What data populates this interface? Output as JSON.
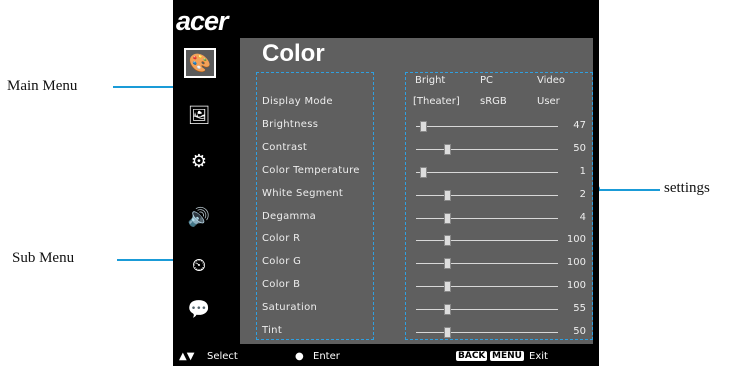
{
  "callouts": {
    "main_menu": "Main Menu",
    "sub_menu": "Sub Menu",
    "settings": "settings"
  },
  "logo": "acer",
  "panel": {
    "title": "Color"
  },
  "display_mode_options": [
    "Bright",
    "PC",
    "Video"
  ],
  "display_mode_values": [
    "[Theater]",
    "sRGB",
    "User"
  ],
  "rows": [
    {
      "label": "Display Mode"
    },
    {
      "label": "Brightness",
      "value": "47",
      "level": 0.03
    },
    {
      "label": "Contrast",
      "value": "50",
      "level": 0.2
    },
    {
      "label": "Color Temperature",
      "value": "1",
      "level": 0.03
    },
    {
      "label": "White Segment",
      "value": "2",
      "level": 0.2
    },
    {
      "label": "Degamma",
      "value": "4",
      "level": 0.2
    },
    {
      "label": "Color R",
      "value": "100",
      "level": 0.2
    },
    {
      "label": "Color G",
      "value": "100",
      "level": 0.2
    },
    {
      "label": "Color B",
      "value": "100",
      "level": 0.2
    },
    {
      "label": "Saturation",
      "value": "55",
      "level": 0.2
    },
    {
      "label": "Tint",
      "value": "50",
      "level": 0.2
    }
  ],
  "footer": {
    "select": "Select",
    "enter": "Enter",
    "back": "BACK",
    "menu": "MENU",
    "exit": "Exit"
  },
  "icons": [
    "palette-icon",
    "image-icon",
    "settings-icon",
    "speaker-icon",
    "timer-icon",
    "language-icon"
  ],
  "accent": "#1a9bd7"
}
